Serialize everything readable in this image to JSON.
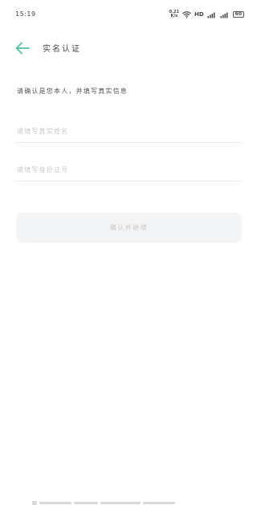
{
  "status_bar": {
    "time": "15:19",
    "net_speed_top": "0.21",
    "net_speed_bottom": "K/s",
    "network_type": "HD",
    "battery": "60",
    "icons": [
      "wifi-icon",
      "signal-icon",
      "signal-icon",
      "battery-icon"
    ]
  },
  "header": {
    "title": "实名认证",
    "back_icon": "arrow-left-icon",
    "accent_color": "#4fc3a1"
  },
  "instruction": "请确认是您本人，并填写真实信息",
  "form": {
    "name_placeholder": "请填写真实姓名",
    "id_placeholder": "请填写身份证号",
    "name_value": "",
    "id_value": ""
  },
  "confirm_button": {
    "label": "确认并继续",
    "state": "disabled"
  }
}
